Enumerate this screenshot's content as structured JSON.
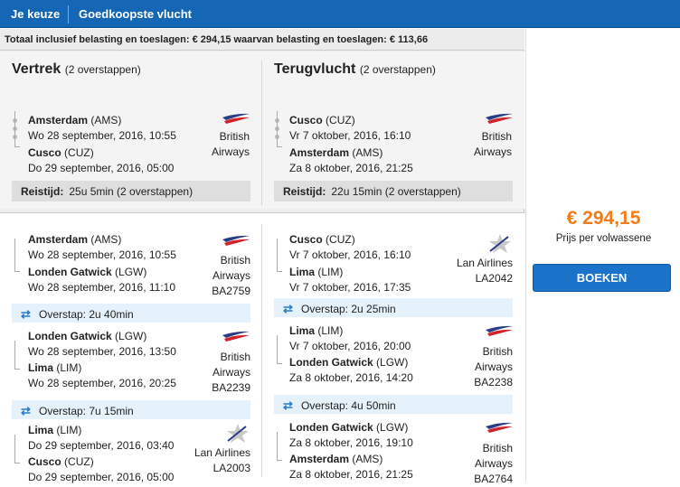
{
  "header": {
    "tab_choice": "Je keuze",
    "tab_title": "Goedkoopste vlucht"
  },
  "total_line": "Totaal inclusief belasting en toeslagen: € 294,15 waarvan belasting en toeslagen: € 113,66",
  "outbound": {
    "title": "Vertrek",
    "stops": "(2 overstappen)",
    "from_city": "Amsterdam",
    "from_code": "(AMS)",
    "from_time": "Wo 28 september, 2016, 10:55",
    "to_city": "Cusco",
    "to_code": "(CUZ)",
    "to_time": "Do 29 september, 2016, 05:00",
    "airline_1": "British",
    "airline_2": "Airways",
    "reistijd_label": "Reistijd:",
    "reistijd_value": "25u 5min (2 overstappen)"
  },
  "inbound": {
    "title": "Terugvlucht",
    "stops": "(2 overstappen)",
    "from_city": "Cusco",
    "from_code": "(CUZ)",
    "from_time": "Vr 7 oktober, 2016, 16:10",
    "to_city": "Amsterdam",
    "to_code": "(AMS)",
    "to_time": "Za 8 oktober, 2016, 21:25",
    "airline_1": "British",
    "airline_2": "Airways",
    "reistijd_label": "Reistijd:",
    "reistijd_value": "22u 15min (2 overstappen)"
  },
  "outbound_legs": [
    {
      "from_city": "Amsterdam",
      "from_code": "(AMS)",
      "from_time": "Wo 28 september, 2016, 10:55",
      "to_city": "Londen Gatwick",
      "to_code": "(LGW)",
      "to_time": "Wo 28 september, 2016, 11:10",
      "airline_1": "British",
      "airline_2": "Airways",
      "flight": "BA2759"
    },
    {
      "from_city": "Londen Gatwick",
      "from_code": "(LGW)",
      "from_time": "Wo 28 september, 2016, 13:50",
      "to_city": "Lima",
      "to_code": "(LIM)",
      "to_time": "Wo 28 september, 2016, 20:25",
      "airline_1": "British",
      "airline_2": "Airways",
      "flight": "BA2239"
    },
    {
      "from_city": "Lima",
      "from_code": "(LIM)",
      "from_time": "Do 29 september, 2016, 03:40",
      "to_city": "Cusco",
      "to_code": "(CUZ)",
      "to_time": "Do 29 september, 2016, 05:00",
      "airline_1": "Lan Airlines",
      "airline_2": "",
      "flight": "LA2003"
    }
  ],
  "outbound_transfers": [
    "Overstap: 2u 40min",
    "Overstap: 7u 15min"
  ],
  "inbound_legs": [
    {
      "from_city": "Cusco",
      "from_code": "(CUZ)",
      "from_time": "Vr 7 oktober, 2016, 16:10",
      "to_city": "Lima",
      "to_code": "(LIM)",
      "to_time": "Vr 7 oktober, 2016, 17:35",
      "airline_1": "Lan Airlines",
      "airline_2": "",
      "flight": "LA2042"
    },
    {
      "from_city": "Lima",
      "from_code": "(LIM)",
      "from_time": "Vr 7 oktober, 2016, 20:00",
      "to_city": "Londen Gatwick",
      "to_code": "(LGW)",
      "to_time": "Za 8 oktober, 2016, 14:20",
      "airline_1": "British",
      "airline_2": "Airways",
      "flight": "BA2238"
    },
    {
      "from_city": "Londen Gatwick",
      "from_code": "(LGW)",
      "from_time": "Za 8 oktober, 2016, 19:10",
      "to_city": "Amsterdam",
      "to_code": "(AMS)",
      "to_time": "Za 8 oktober, 2016, 21:25",
      "airline_1": "British",
      "airline_2": "Airways",
      "flight": "BA2764"
    }
  ],
  "inbound_transfers": [
    "Overstap: 2u 25min",
    "Overstap: 4u 50min"
  ],
  "price": {
    "value": "€ 294,15",
    "label": "Prijs per volwassene"
  },
  "book_label": "BOEKEN",
  "icons": {
    "transfer": "transfer-arrows-icon",
    "ba_logo": "british-airways-logo",
    "lan_logo": "lan-airlines-logo"
  },
  "colors": {
    "header": "#1566b4",
    "price": "#ef7d18",
    "button": "#1a72c9",
    "transfer_bg": "#e6f2fb"
  }
}
